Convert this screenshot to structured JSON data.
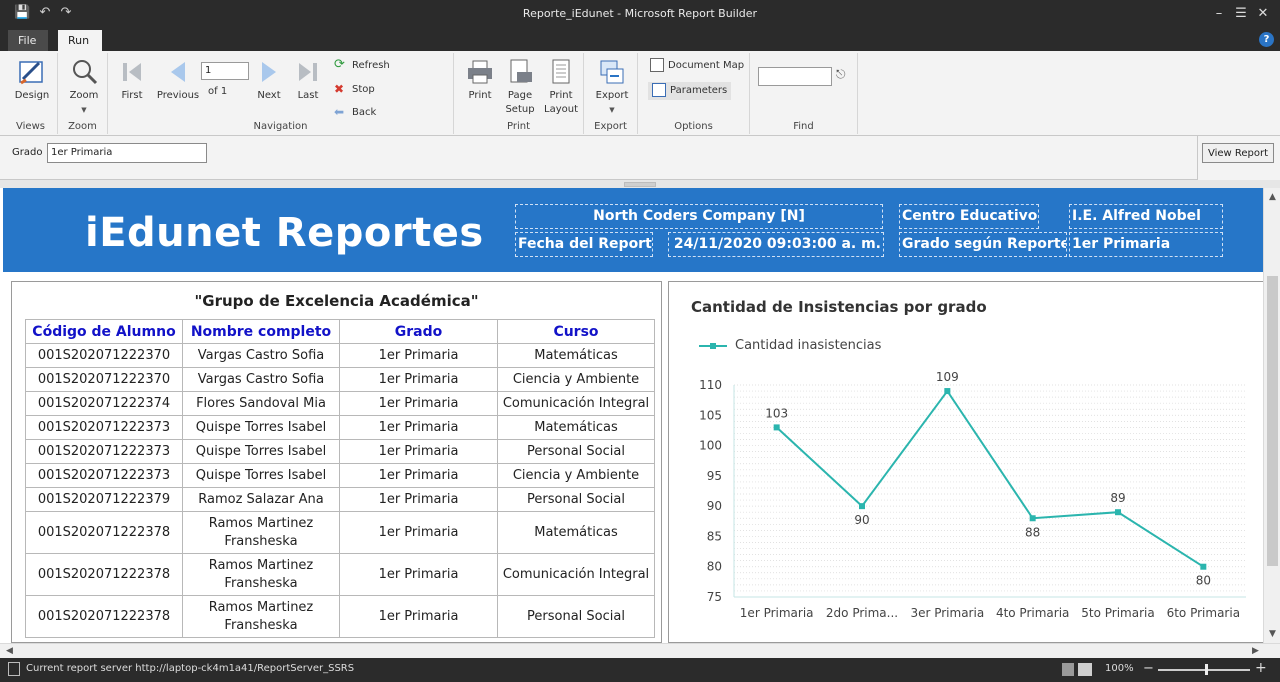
{
  "window": {
    "title": "Reporte_iEdunet - Microsoft Report Builder",
    "tabs": [
      "File",
      "Run"
    ],
    "help": "?"
  },
  "ribbon": {
    "views": {
      "label": "Views",
      "design": "Design"
    },
    "zoom": {
      "label": "Zoom",
      "zoom": "Zoom"
    },
    "navigation": {
      "label": "Navigation",
      "first": "First",
      "previous": "Previous",
      "page": "1",
      "of": "of  1",
      "next": "Next",
      "last": "Last",
      "refresh": "Refresh",
      "stop": "Stop",
      "back": "Back"
    },
    "print": {
      "label": "Print",
      "print": "Print",
      "page_setup_1": "Page",
      "page_setup_2": "Setup",
      "print_layout_1": "Print",
      "print_layout_2": "Layout"
    },
    "export": {
      "label": "Export",
      "export": "Export"
    },
    "options": {
      "label": "Options",
      "document_map": "Document Map",
      "parameters": "Parameters"
    },
    "find": {
      "label": "Find"
    }
  },
  "parameters": {
    "grado_label": "Grado",
    "grado_value": "1er Primaria",
    "view_report": "View Report"
  },
  "report": {
    "banner_title": "iEdunet Reportes",
    "company": "North Coders Company [N]",
    "fecha_label": "Fecha del Reporte:",
    "fecha_value": "24/11/2020 09:03:00 a. m.",
    "centro_label": "Centro Educativo:",
    "centro_value": "I.E. Alfred Nobel",
    "grado_label": "Grado según Reporte:",
    "grado_value": "1er Primaria",
    "table_title": "\"Grupo de Excelencia Académica\"",
    "columns": [
      "Código de Alumno",
      "Nombre completo",
      "Grado",
      "Curso"
    ],
    "rows": [
      [
        "001S202071222370",
        "Vargas Castro Sofia",
        "1er Primaria",
        "Matemáticas"
      ],
      [
        "001S202071222370",
        "Vargas Castro Sofia",
        "1er Primaria",
        "Ciencia y Ambiente"
      ],
      [
        "001S202071222374",
        "Flores Sandoval Mia",
        "1er Primaria",
        "Comunicación Integral"
      ],
      [
        "001S202071222373",
        "Quispe Torres Isabel",
        "1er Primaria",
        "Matemáticas"
      ],
      [
        "001S202071222373",
        "Quispe Torres Isabel",
        "1er Primaria",
        "Personal Social"
      ],
      [
        "001S202071222373",
        "Quispe Torres Isabel",
        "1er Primaria",
        "Ciencia y Ambiente"
      ],
      [
        "001S202071222379",
        "Ramoz Salazar Ana",
        "1er Primaria",
        "Personal Social"
      ],
      [
        "001S202071222378",
        "Ramos Martinez Fransheska",
        "1er Primaria",
        "Matemáticas"
      ],
      [
        "001S202071222378",
        "Ramos Martinez Fransheska",
        "1er Primaria",
        "Comunicación Integral"
      ],
      [
        "001S202071222378",
        "Ramos Martinez Fransheska",
        "1er Primaria",
        "Personal Social"
      ]
    ]
  },
  "chart_data": {
    "type": "line",
    "title": "Cantidad de Insistencias por grado",
    "x": [
      "1er Primaria",
      "2do  Prima...",
      "3er Primaria",
      "4to Primaria",
      "5to Primaria",
      "6to Primaria"
    ],
    "series": [
      {
        "name": "Cantidad inasistencias",
        "values": [
          103,
          90,
          109,
          88,
          89,
          80
        ]
      }
    ],
    "yticks": [
      75,
      80,
      85,
      90,
      95,
      100,
      105,
      110
    ],
    "ylim": [
      75,
      110
    ],
    "xlabel": "",
    "ylabel": "",
    "legend": "top-left",
    "grid": true,
    "color": "#2bb5ae"
  },
  "status": {
    "server": "Current report server http://laptop-ck4m1a41/ReportServer_SSRS",
    "zoom": "100%"
  }
}
